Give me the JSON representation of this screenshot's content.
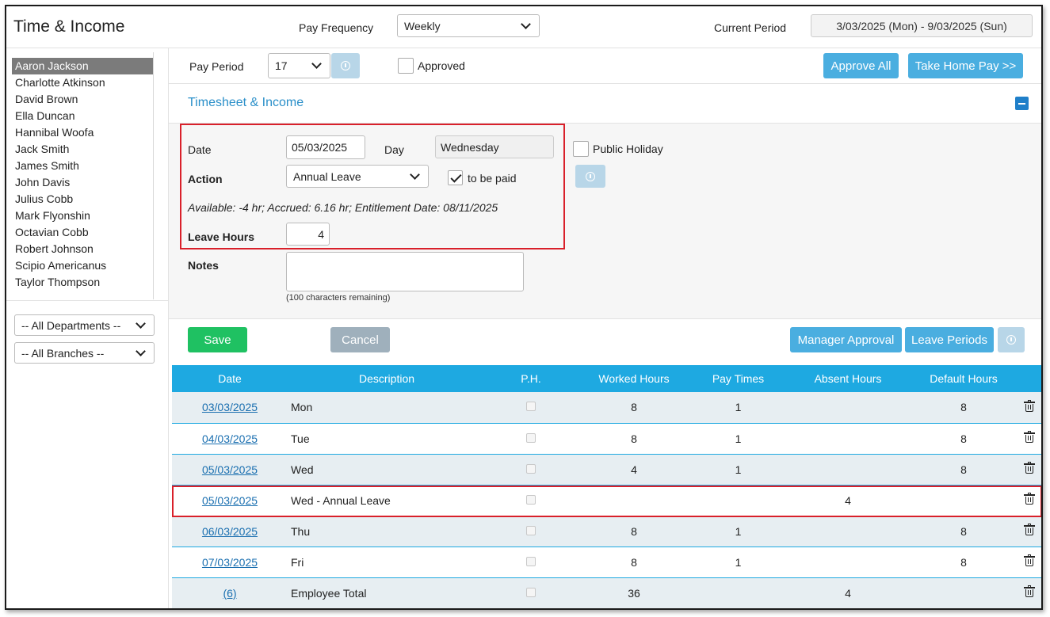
{
  "header": {
    "title": "Time & Income",
    "pay_frequency_label": "Pay Frequency",
    "pay_frequency_value": "Weekly",
    "current_period_label": "Current Period",
    "current_period_value": "3/03/2025 (Mon) - 9/03/2025 (Sun)"
  },
  "sidebar": {
    "employees": [
      "Aaron Jackson",
      "Charlotte Atkinson",
      "David Brown",
      "Ella Duncan",
      "Hannibal Woofa",
      "Jack Smith",
      "James Smith",
      "John Davis",
      "Julius Cobb",
      "Mark Flyonshin",
      "Octavian Cobb",
      "Robert Johnson",
      "Scipio Americanus",
      "Taylor Thompson"
    ],
    "selected_index": 0,
    "department_filter": "-- All Departments --",
    "branch_filter": "-- All Branches --"
  },
  "toolbar": {
    "pay_period_label": "Pay Period",
    "pay_period_value": "17",
    "approved_label": "Approved",
    "approve_all_label": "Approve All",
    "take_home_label": "Take Home Pay >>"
  },
  "section": {
    "title": "Timesheet & Income"
  },
  "form": {
    "date_label": "Date",
    "date_value": "05/03/2025",
    "day_label": "Day",
    "day_value": "Wednesday",
    "public_holiday_label": "Public Holiday",
    "action_label": "Action",
    "action_value": "Annual Leave",
    "to_be_paid_label": "to be paid",
    "leave_info": "Available: -4 hr; Accrued: 6.16 hr; Entitlement Date: 08/11/2025",
    "leave_hours_label": "Leave Hours",
    "leave_hours_value": "4",
    "notes_label": "Notes",
    "notes_remaining": "(100 characters remaining)"
  },
  "actions": {
    "save_label": "Save",
    "cancel_label": "Cancel",
    "manager_approval_label": "Manager Approval",
    "leave_periods_label": "Leave Periods"
  },
  "table": {
    "headers": [
      "Date",
      "Description",
      "P.H.",
      "Worked Hours",
      "Pay Times",
      "Absent Hours",
      "Default Hours"
    ],
    "rows": [
      {
        "date": "03/03/2025",
        "desc": "Mon",
        "worked": "8",
        "pay": "1",
        "absent": "",
        "default": "8"
      },
      {
        "date": "04/03/2025",
        "desc": "Tue",
        "worked": "8",
        "pay": "1",
        "absent": "",
        "default": "8"
      },
      {
        "date": "05/03/2025",
        "desc": "Wed",
        "worked": "4",
        "pay": "1",
        "absent": "",
        "default": "8"
      },
      {
        "date": "05/03/2025",
        "desc": "Wed - Annual Leave",
        "worked": "",
        "pay": "",
        "absent": "4",
        "default": ""
      },
      {
        "date": "06/03/2025",
        "desc": "Thu",
        "worked": "8",
        "pay": "1",
        "absent": "",
        "default": "8"
      },
      {
        "date": "07/03/2025",
        "desc": "Fri",
        "worked": "8",
        "pay": "1",
        "absent": "",
        "default": "8"
      },
      {
        "date": "(6)",
        "desc": "Employee Total",
        "worked": "36",
        "pay": "",
        "absent": "4",
        "default": ""
      }
    ]
  },
  "colors": {
    "accent": "#1ea9e1",
    "button_blue": "#4aaee0",
    "save_green": "#1fc162",
    "highlight_red": "#d9202a",
    "link_blue": "#1a6fb0"
  }
}
